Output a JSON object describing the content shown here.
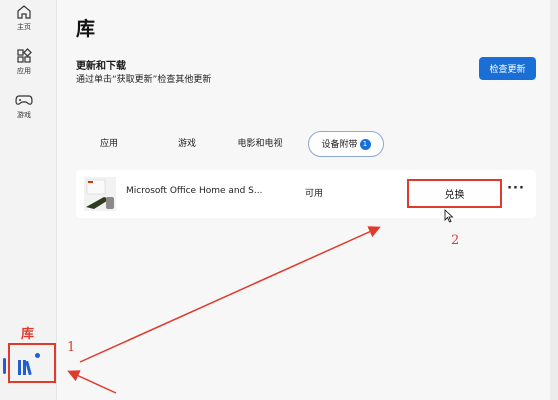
{
  "nav": {
    "home_label": "主页",
    "apps_label": "应用",
    "games_label": "游戏"
  },
  "page": {
    "title": "库"
  },
  "updates": {
    "title": "更新和下载",
    "description": "通过单击“获取更新”检查其他更新",
    "check_button": "检查更新"
  },
  "tabs": [
    {
      "label": "应用"
    },
    {
      "label": "游戏"
    },
    {
      "label": "电影和电视"
    },
    {
      "label": "设备附带",
      "badge": "1",
      "selected": true
    }
  ],
  "items": [
    {
      "name": "Microsoft Office Home and S...",
      "status": "可用",
      "action": "兑换"
    }
  ],
  "more_label": "···",
  "annotations": {
    "lib": "库",
    "step1": "1",
    "step2": "2"
  },
  "colors": {
    "accent": "#1a6fd6",
    "annotation": "#e03a2c"
  }
}
